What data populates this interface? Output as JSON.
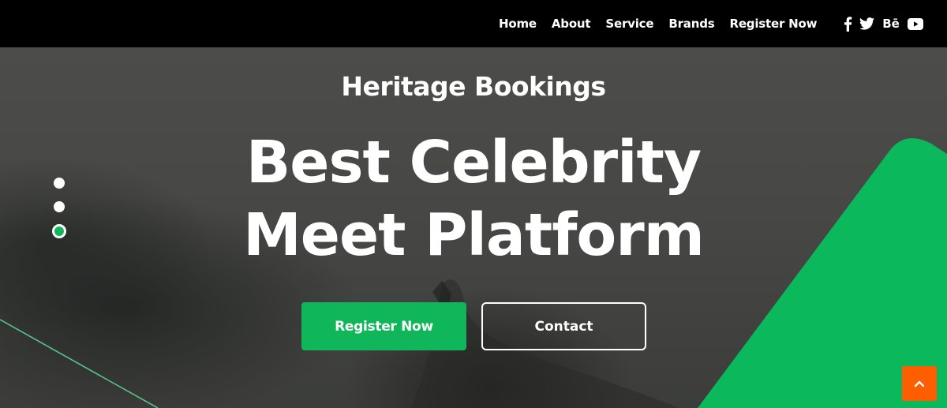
{
  "nav": {
    "items": [
      {
        "label": "Home"
      },
      {
        "label": "About"
      },
      {
        "label": "Service"
      },
      {
        "label": "Brands"
      },
      {
        "label": "Register Now"
      }
    ]
  },
  "social": [
    {
      "icon": "facebook-icon"
    },
    {
      "icon": "twitter-icon"
    },
    {
      "icon": "behance-icon",
      "text": "Bē"
    },
    {
      "icon": "youtube-icon"
    }
  ],
  "hero": {
    "subtitle": "Heritage Bookings",
    "headline_line1": "Best Celebrity",
    "headline_line2": "Meet Platform",
    "primary_button": "Register Now",
    "secondary_button": "Contact"
  },
  "slider": {
    "dot_count": 3,
    "active_index": 2
  },
  "colors": {
    "accent": "#0fb75a",
    "scroll_top": "#ff5e00",
    "nav_bg": "#000000"
  }
}
